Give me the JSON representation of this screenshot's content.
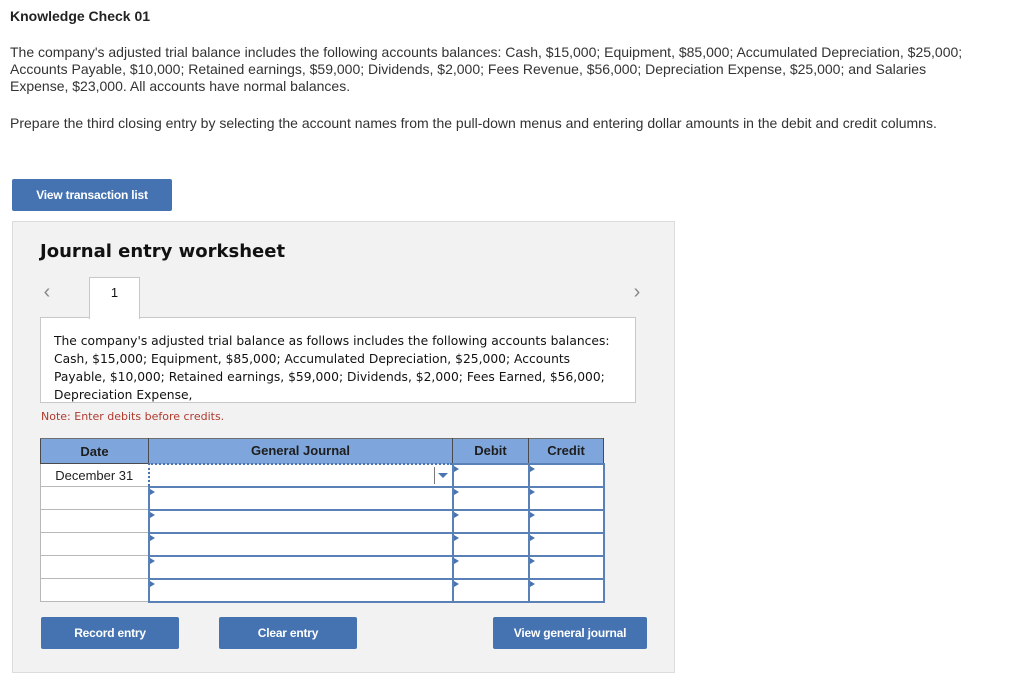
{
  "page": {
    "title": "Knowledge Check 01",
    "paragraph1": "The company's adjusted trial balance includes the following accounts balances: Cash, $15,000; Equipment, $85,000; Accumulated Depreciation, $25,000; Accounts Payable, $10,000; Retained earnings, $59,000; Dividends, $2,000; Fees Revenue, $56,000; Depreciation Expense, $25,000; and Salaries Expense, $23,000. All accounts have normal balances.",
    "paragraph2": "Prepare the third closing entry by selecting the account names from the pull-down menus and entering dollar amounts in the debit and credit columns.",
    "view_transaction_list_label": "View transaction list"
  },
  "worksheet": {
    "title": "Journal entry worksheet",
    "prev_icon": "chevron-left-icon",
    "next_icon": "chevron-right-icon",
    "tabs": [
      {
        "label": "1"
      }
    ],
    "description": "The company's adjusted trial balance as follows includes the following accounts balances: Cash, $15,000; Equipment, $85,000; Accumulated Depreciation, $25,000; Accounts Payable, $10,000; Retained earnings, $59,000; Dividends, $2,000; Fees Earned, $56,000; Depreciation Expense,",
    "note": "Note: Enter debits before credits.",
    "table": {
      "headers": {
        "date": "Date",
        "journal": "General Journal",
        "debit": "Debit",
        "credit": "Credit"
      },
      "rows": [
        {
          "date": "December 31",
          "account": "",
          "debit": "",
          "credit": ""
        },
        {
          "date": "",
          "account": "",
          "debit": "",
          "credit": ""
        },
        {
          "date": "",
          "account": "",
          "debit": "",
          "credit": ""
        },
        {
          "date": "",
          "account": "",
          "debit": "",
          "credit": ""
        },
        {
          "date": "",
          "account": "",
          "debit": "",
          "credit": ""
        },
        {
          "date": "",
          "account": "",
          "debit": "",
          "credit": ""
        }
      ]
    },
    "buttons": {
      "record": "Record entry",
      "clear": "Clear entry",
      "view_general_journal": "View general journal"
    }
  },
  "colors": {
    "button_blue": "#4573b2",
    "header_blue": "#7fa6dc",
    "note_red": "#b03a2e",
    "panel_bg": "#f2f2f2"
  }
}
